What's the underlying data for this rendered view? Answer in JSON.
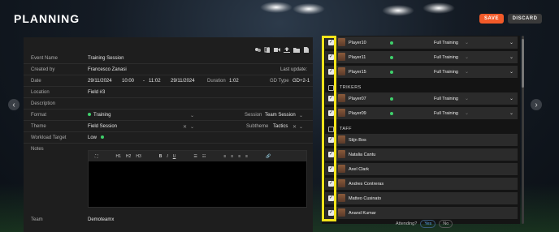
{
  "header": {
    "title": "PLANNING",
    "save_label": "SAVE",
    "discard_label": "DISCARD"
  },
  "form": {
    "event_name_label": "Event Name",
    "event_name": "Training Session",
    "created_by_label": "Created by",
    "created_by": "Francesco Zanasi",
    "last_update_label": "Last update:",
    "date_label": "Date",
    "start_date": "29/11/2024",
    "start_time": "10:00",
    "dash": "-",
    "end_time": "11:02",
    "end_date": "29/11/2024",
    "duration_label": "Duration",
    "duration": "1:02",
    "gd_label": "GD Type",
    "gd_value": "GD+2-1",
    "location_label": "Location",
    "location": "Field #3",
    "description_label": "Description",
    "format_label": "Format",
    "format": "Training",
    "session_label": "Session",
    "session": "Team Session",
    "theme_label": "Theme",
    "theme": "Field Session",
    "subtheme_label": "Subtheme",
    "subtheme": "Tactics",
    "workload_label": "Workload Target",
    "workload": "Low",
    "notes_label": "Notes",
    "team_label": "Team",
    "team": "Demoteamx"
  },
  "editor_toolbar": [
    "⛶",
    "H1",
    "H2",
    "H3",
    "B",
    "I",
    "U",
    "☰",
    "☷",
    "≡",
    "≡",
    "≡",
    "≡",
    "🔗"
  ],
  "players": {
    "rows_top": [
      {
        "name": "Player10",
        "attendance": "Full Training"
      },
      {
        "name": "Player11",
        "attendance": "Full Training"
      },
      {
        "name": "Player15",
        "attendance": "Full Training"
      }
    ],
    "section_strikers": "TRIKERS",
    "strikers": [
      {
        "name": "Player07",
        "attendance": "Full Training"
      },
      {
        "name": "Player09",
        "attendance": "Full Training"
      }
    ],
    "section_staff": "TAFF",
    "staff": [
      {
        "name": "Stijn Bos"
      },
      {
        "name": "Natalia Cantu"
      },
      {
        "name": "Axel Clark"
      },
      {
        "name": "Andres Contreras"
      },
      {
        "name": "Matteo Cusinato"
      },
      {
        "name": "Anand Kumar"
      }
    ]
  },
  "attending": {
    "label": "Attending?",
    "yes": "Yes",
    "no": "No"
  },
  "colors": {
    "accent": "#f25a29",
    "highlight": "#f4e41a",
    "online": "#3fcf6b"
  }
}
